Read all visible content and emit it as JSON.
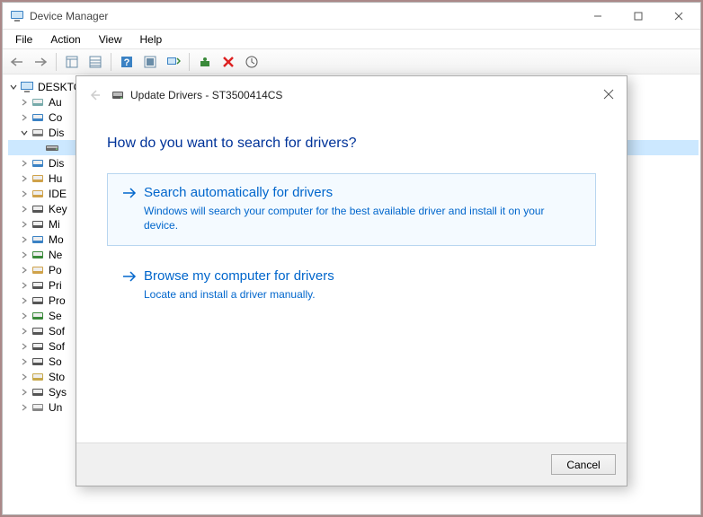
{
  "window": {
    "title": "Device Manager"
  },
  "menubar": [
    "File",
    "Action",
    "View",
    "Help"
  ],
  "tree": {
    "root": "DESKTO",
    "nodes": [
      {
        "label": "Au",
        "iconColor": "#7aa",
        "twister": ">"
      },
      {
        "label": "Co",
        "iconColor": "#3b82c4",
        "twister": ">"
      },
      {
        "label": "Dis",
        "iconColor": "#777",
        "twister": "v",
        "expanded": true
      },
      {
        "label": "Dis",
        "iconColor": "#3b82c4",
        "twister": ">"
      },
      {
        "label": "Hu",
        "iconColor": "#cfa24a",
        "twister": ">"
      },
      {
        "label": "IDE",
        "iconColor": "#cfa24a",
        "twister": ">"
      },
      {
        "label": "Key",
        "iconColor": "#555",
        "twister": ">"
      },
      {
        "label": "Mi",
        "iconColor": "#555",
        "twister": ">"
      },
      {
        "label": "Mo",
        "iconColor": "#3b82c4",
        "twister": ">"
      },
      {
        "label": "Ne",
        "iconColor": "#3a8a3a",
        "twister": ">"
      },
      {
        "label": "Po",
        "iconColor": "#cfa24a",
        "twister": ">"
      },
      {
        "label": "Pri",
        "iconColor": "#555",
        "twister": ">"
      },
      {
        "label": "Pro",
        "iconColor": "#555",
        "twister": ">"
      },
      {
        "label": "Se",
        "iconColor": "#3a8a3a",
        "twister": ">"
      },
      {
        "label": "Sof",
        "iconColor": "#555",
        "twister": ">"
      },
      {
        "label": "Sof",
        "iconColor": "#555",
        "twister": ">"
      },
      {
        "label": "So",
        "iconColor": "#555",
        "twister": ">"
      },
      {
        "label": "Sto",
        "iconColor": "#c7a84a",
        "twister": ">"
      },
      {
        "label": "Sys",
        "iconColor": "#555",
        "twister": ">"
      },
      {
        "label": "Un",
        "iconColor": "#888",
        "twister": ">"
      }
    ]
  },
  "dialog": {
    "title": "Update Drivers - ST3500414CS",
    "heading": "How do you want to search for drivers?",
    "options": [
      {
        "title": "Search automatically for drivers",
        "desc": "Windows will search your computer for the best available driver and install it on your device.",
        "hover": true
      },
      {
        "title": "Browse my computer for drivers",
        "desc": "Locate and install a driver manually.",
        "hover": false
      }
    ],
    "cancel": "Cancel"
  }
}
